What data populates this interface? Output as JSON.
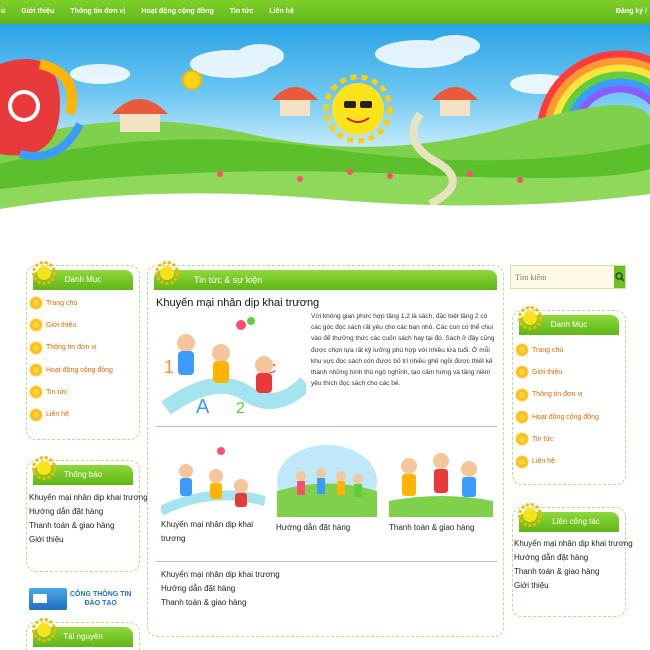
{
  "nav": {
    "items": [
      "ủ",
      "Giới thiệu",
      "Thông tin đơn vị",
      "Hoạt động cộng đồng",
      "Tin tức",
      "Liên hệ"
    ],
    "right": "Đăng ký /"
  },
  "left": {
    "menu_title": "Danh Mục",
    "menu_items": [
      "Trang chủ",
      "Giới thiệu",
      "Thông tin đơn vị",
      "Hoạt động cộng đồng",
      "Tin tức",
      "Liên hệ"
    ],
    "notice_title": "Thông báo",
    "notice_items": [
      "Khuyến mại nhân dịp khai trương",
      "Hướng dẫn đặt hàng",
      "Thanh toán & giao hàng",
      "Giới thiệu"
    ],
    "logo_line1": "CỔNG THÔNG TIN",
    "logo_line2": "ĐÀO TẠO",
    "resource_title": "Tài nguyên"
  },
  "center": {
    "title": "Tin tức & sự kiện",
    "article_title": "Khuyến mại nhân dịp khai trương",
    "article_body": "Với không gian phức hợp tầng 1,2 là sách, đặc biệt tầng 2 có các góc đọc sách rất yêu cho các bạn nhỏ. Các con có thể chui vào để thưởng thức các cuốn sách hay tại đó. Sách ở đây cũng được chọn lựa rất kỹ lưỡng phù hợp với nhiều lứa tuổi. Ở mỗi khu vực đọc sách còn được bố trí nhiều ghế ngồi được thiết kế thành những hình thù ngộ nghĩnh, tạo cảm hứng và tăng niềm yêu thích đọc sách cho các bé.",
    "thumbs": [
      "Khuyến mại nhân dịp khai trương",
      "Hướng dẫn đặt hàng",
      "Thanh toán & giao hàng"
    ],
    "links": [
      "Khuyến mại nhân dịp khai trương",
      "Hướng dẫn đặt hàng",
      "Thanh toán & giao hàng"
    ]
  },
  "right": {
    "search_placeholder": "Tìm kiếm",
    "menu_title": "Danh Mục",
    "menu_items": [
      "Trang chủ",
      "Giới thiệu",
      "Thông tin đơn vị",
      "Hoạt động cộng đồng",
      "Tin tức",
      "Liên hệ"
    ],
    "contact_title": "Liên công tác",
    "contact_items": [
      "Khuyến mại nhân dịp khai trương",
      "Hướng dẫn đặt hàng",
      "Thanh toán & giao hàng",
      "Giới thiệu"
    ]
  },
  "colors": {
    "green": "#6cc11e",
    "orange": "#e26a00",
    "border": "#b7dd8a"
  }
}
